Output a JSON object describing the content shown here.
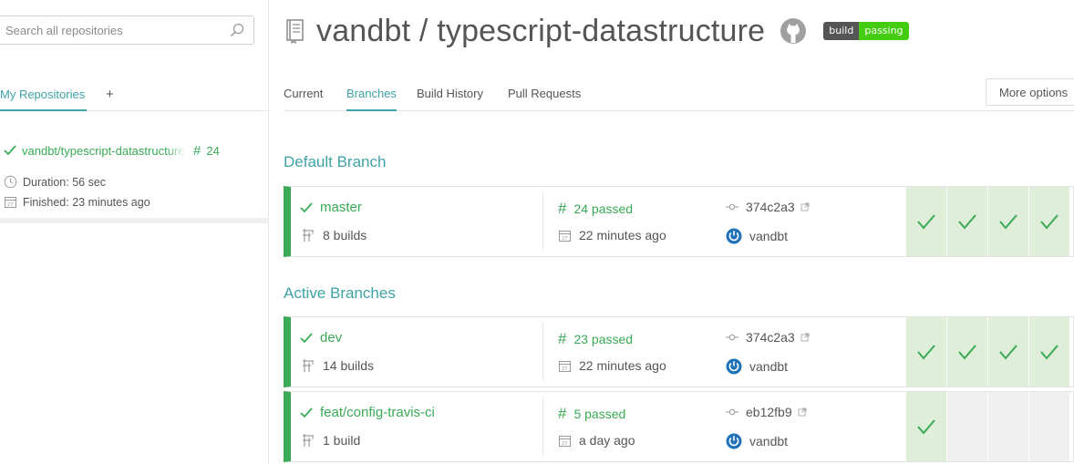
{
  "sidebar": {
    "search_placeholder": "Search all repositories",
    "tab_label": "My Repositories",
    "add_label": "+",
    "repo": {
      "name": "vandbt/typescript-datastructure",
      "build_number": "24",
      "duration": "Duration: 56 sec",
      "finished": "Finished: 23 minutes ago"
    }
  },
  "header": {
    "title": "vandbt / typescript-datastructure",
    "badge_left": "build",
    "badge_right": "passing"
  },
  "tabs": [
    {
      "label": "Current"
    },
    {
      "label": "Branches"
    },
    {
      "label": "Build History"
    },
    {
      "label": "Pull Requests"
    }
  ],
  "more_options": "More options",
  "sections": {
    "default_title": "Default Branch",
    "active_title": "Active Branches"
  },
  "branches": [
    {
      "name": "master",
      "builds": "8 builds",
      "status": "24 passed",
      "time": "22 minutes ago",
      "commit": "374c2a3",
      "author": "vandbt",
      "history": [
        "passed",
        "passed",
        "passed",
        "passed"
      ]
    },
    {
      "name": "dev",
      "builds": "14 builds",
      "status": "23 passed",
      "time": "22 minutes ago",
      "commit": "374c2a3",
      "author": "vandbt",
      "history": [
        "passed",
        "passed",
        "passed",
        "passed"
      ]
    },
    {
      "name": "feat/config-travis-ci",
      "builds": "1 build",
      "status": "5 passed",
      "time": "a day ago",
      "commit": "eb12fb9",
      "author": "vandbt",
      "history": [
        "passed",
        "empty",
        "empty",
        "empty"
      ]
    }
  ],
  "colors": {
    "accent": "#3ea2a6",
    "passed": "#39aa56",
    "passed_bg": "#deeed9",
    "badge_pass": "#44cc11"
  },
  "icons": {
    "search": "search-icon",
    "check": "check-icon",
    "clock": "clock-icon",
    "calendar": "calendar-icon",
    "hash": "hash-icon",
    "commit": "commit-icon",
    "external": "external-link-icon",
    "builds": "builds-icon",
    "avatar": "power-avatar-icon",
    "repo": "repo-book-icon",
    "github": "github-icon"
  }
}
